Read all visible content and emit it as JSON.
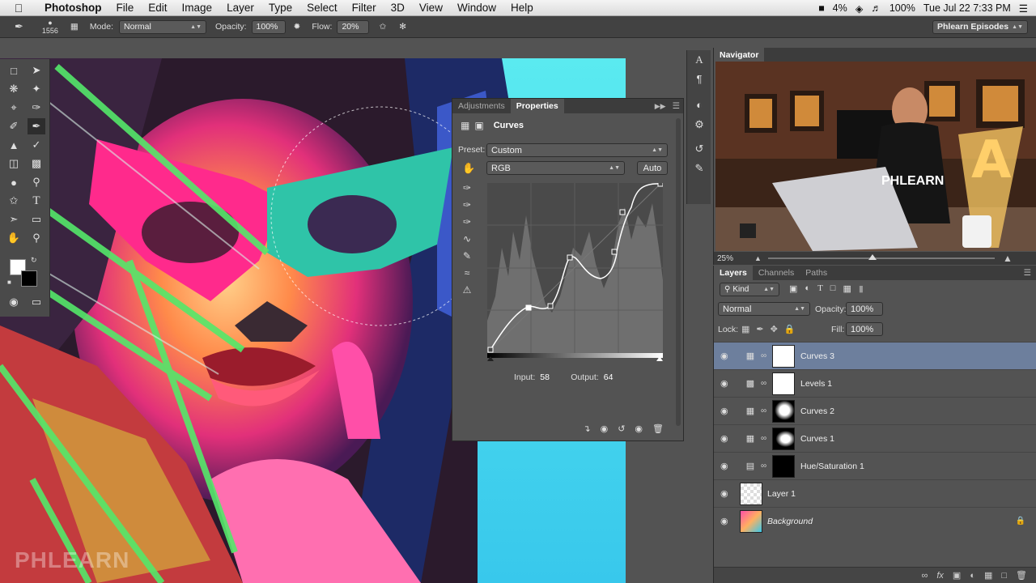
{
  "menubar": {
    "app_name": "Photoshop",
    "menus": [
      "File",
      "Edit",
      "Image",
      "Layer",
      "Type",
      "Select",
      "Filter",
      "3D",
      "View",
      "Window",
      "Help"
    ],
    "battery_small": "4%",
    "battery": "100%",
    "clock": "Tue Jul 22  7:33 PM"
  },
  "options_bar": {
    "brush_size": "1556",
    "mode_label": "Mode:",
    "mode_value": "Normal",
    "opacity_label": "Opacity:",
    "opacity_value": "100%",
    "flow_label": "Flow:",
    "flow_value": "20%",
    "workspace": "Phlearn Episodes"
  },
  "watermark": "PHLEARN",
  "properties": {
    "tabs": [
      "Adjustments",
      "Properties"
    ],
    "title": "Curves",
    "preset_label": "Preset:",
    "preset_value": "Custom",
    "channel": "RGB",
    "auto_label": "Auto",
    "input_label": "Input:",
    "input_value": "58",
    "output_label": "Output:",
    "output_value": "64"
  },
  "navigator": {
    "title": "Navigator",
    "zoom": "25%",
    "shirt_text": "PHLEARN",
    "sign_letter": "A"
  },
  "layers_panel": {
    "tabs": [
      "Layers",
      "Channels",
      "Paths"
    ],
    "kind_label": "Kind",
    "blend_mode": "Normal",
    "opacity_label": "Opacity:",
    "opacity_value": "100%",
    "lock_label": "Lock:",
    "fill_label": "Fill:",
    "fill_value": "100%",
    "layers": [
      {
        "name": "Curves 3",
        "selected": true
      },
      {
        "name": "Levels 1",
        "selected": false
      },
      {
        "name": "Curves 2",
        "selected": false
      },
      {
        "name": "Curves 1",
        "selected": false
      },
      {
        "name": "Hue/Saturation 1",
        "selected": false
      },
      {
        "name": "Layer 1",
        "selected": false
      },
      {
        "name": "Background",
        "selected": false
      }
    ]
  }
}
